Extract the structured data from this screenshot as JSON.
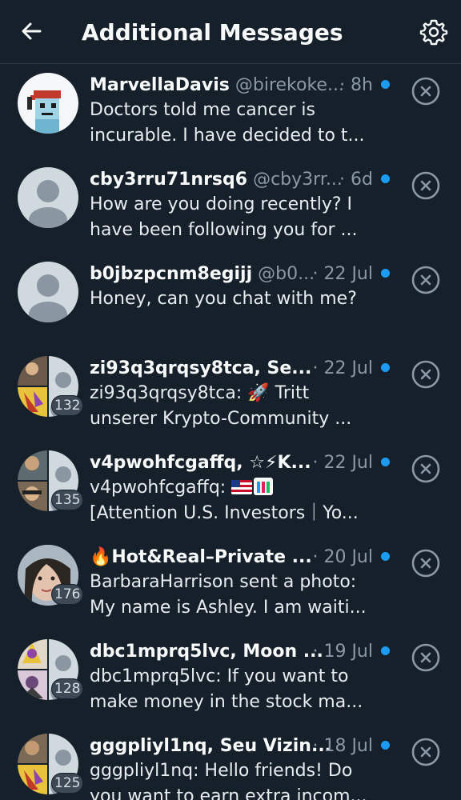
{
  "header": {
    "title": "Additional Messages",
    "back_icon": "arrow-left-icon",
    "settings_icon": "gear-icon"
  },
  "colors": {
    "background": "#15202b",
    "unread_dot": "#1d9bf0",
    "secondary_text": "#8b98a5"
  },
  "conversations": [
    {
      "name": "MarvellaDavis",
      "handle": "@birekoke...",
      "time": "· 8h",
      "unread": true,
      "line1": "Doctors told me cancer is",
      "line2": "incurable. I have decided to t...",
      "group_count": ""
    },
    {
      "name": "cby3rru71nrsq6",
      "handle": "@cby3rr...",
      "time": "· 6d",
      "unread": true,
      "line1": "How are you doing recently? I",
      "line2": "have been following you for ...",
      "group_count": ""
    },
    {
      "name": "b0jbzpcnm8egijj",
      "handle": "@b0...",
      "time": "· 22 Jul",
      "unread": true,
      "line1": "Honey, can you chat with me?",
      "line2": "",
      "group_count": ""
    },
    {
      "name": "zi93q3qrqsy8tca, Se...",
      "handle": "",
      "time": "· 22 Jul",
      "unread": true,
      "line1": "zi93q3qrqsy8tca: 🚀 Tritt",
      "line2": "unserer Krypto-Community ...",
      "group_count": "132"
    },
    {
      "name": "v4pwohfcgaffq, ☆⚡K...",
      "handle": "",
      "time": "· 22 Jul",
      "unread": true,
      "line1": "v4pwohfcgaffq: ",
      "line2": "[Attention U.S. Investors｜Yo...",
      "group_count": "135"
    },
    {
      "name": "🔥Hot&Real–Private ...",
      "handle": "",
      "time": "· 20 Jul",
      "unread": true,
      "line1": "BarbaraHarrison sent a photo:",
      "line2": "My name is Ashley. I am waiti...",
      "group_count": "176"
    },
    {
      "name": "dbc1mprq5lvc, Moon ...",
      "handle": "",
      "time": "· 19 Jul",
      "unread": true,
      "line1": "dbc1mprq5lvc: If you want to",
      "line2": "make money in the stock ma...",
      "group_count": "128"
    },
    {
      "name": "gggpliyl1nq, Seu Vizin...",
      "handle": "",
      "time": "· 18 Jul",
      "unread": true,
      "line1": "gggpliyl1nq: Hello friends! Do",
      "line2": "you want to earn extra incom...",
      "group_count": "125"
    }
  ]
}
